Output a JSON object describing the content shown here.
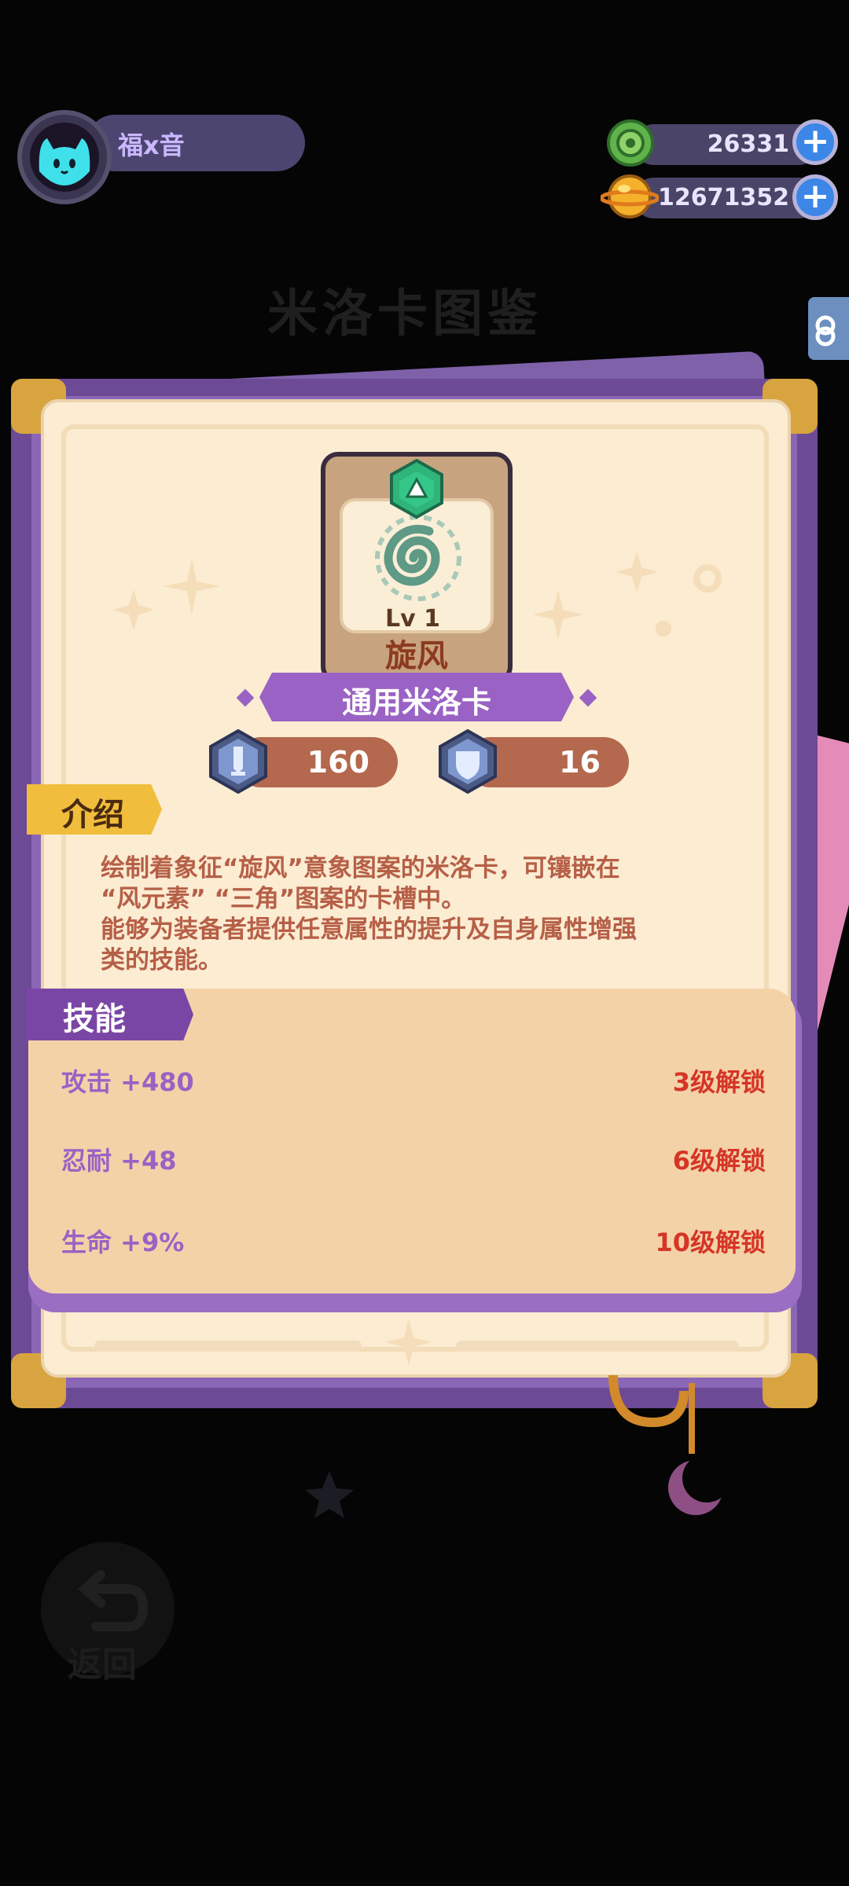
{
  "player": {
    "name": "福x音"
  },
  "currency": [
    {
      "icon": "green-gem-icon",
      "amount": "26331"
    },
    {
      "icon": "gold-coin-icon",
      "amount": "12671352"
    }
  ],
  "background": {
    "title": "米洛卡图鉴",
    "back_label": "返回"
  },
  "card": {
    "level": "Lv 1",
    "name": "旋风",
    "type_label": "通用米洛卡",
    "attack": "160",
    "defense": "16"
  },
  "intro": {
    "label": "介绍",
    "lines": [
      "绘制着象征“旋风”意象图案的米洛卡，可镶嵌在",
      "“风元素” “三角”图案的卡槽中。",
      "能够为装备者提供任意属性的提升及自身属性增强",
      "类的技能。"
    ]
  },
  "skills": {
    "label": "技能",
    "items": [
      {
        "name": "攻击 +480",
        "unlock": "3级解锁"
      },
      {
        "name": "忍耐 +48",
        "unlock": "6级解锁"
      },
      {
        "name": "生命 +9%",
        "unlock": "10级解锁"
      }
    ]
  },
  "colors": {
    "frame": "#6c4a96",
    "paper": "#fbecd2",
    "ribbon": "#9a62c4",
    "unlock_text": "#d63526",
    "stat_bar": "#b4684d"
  }
}
